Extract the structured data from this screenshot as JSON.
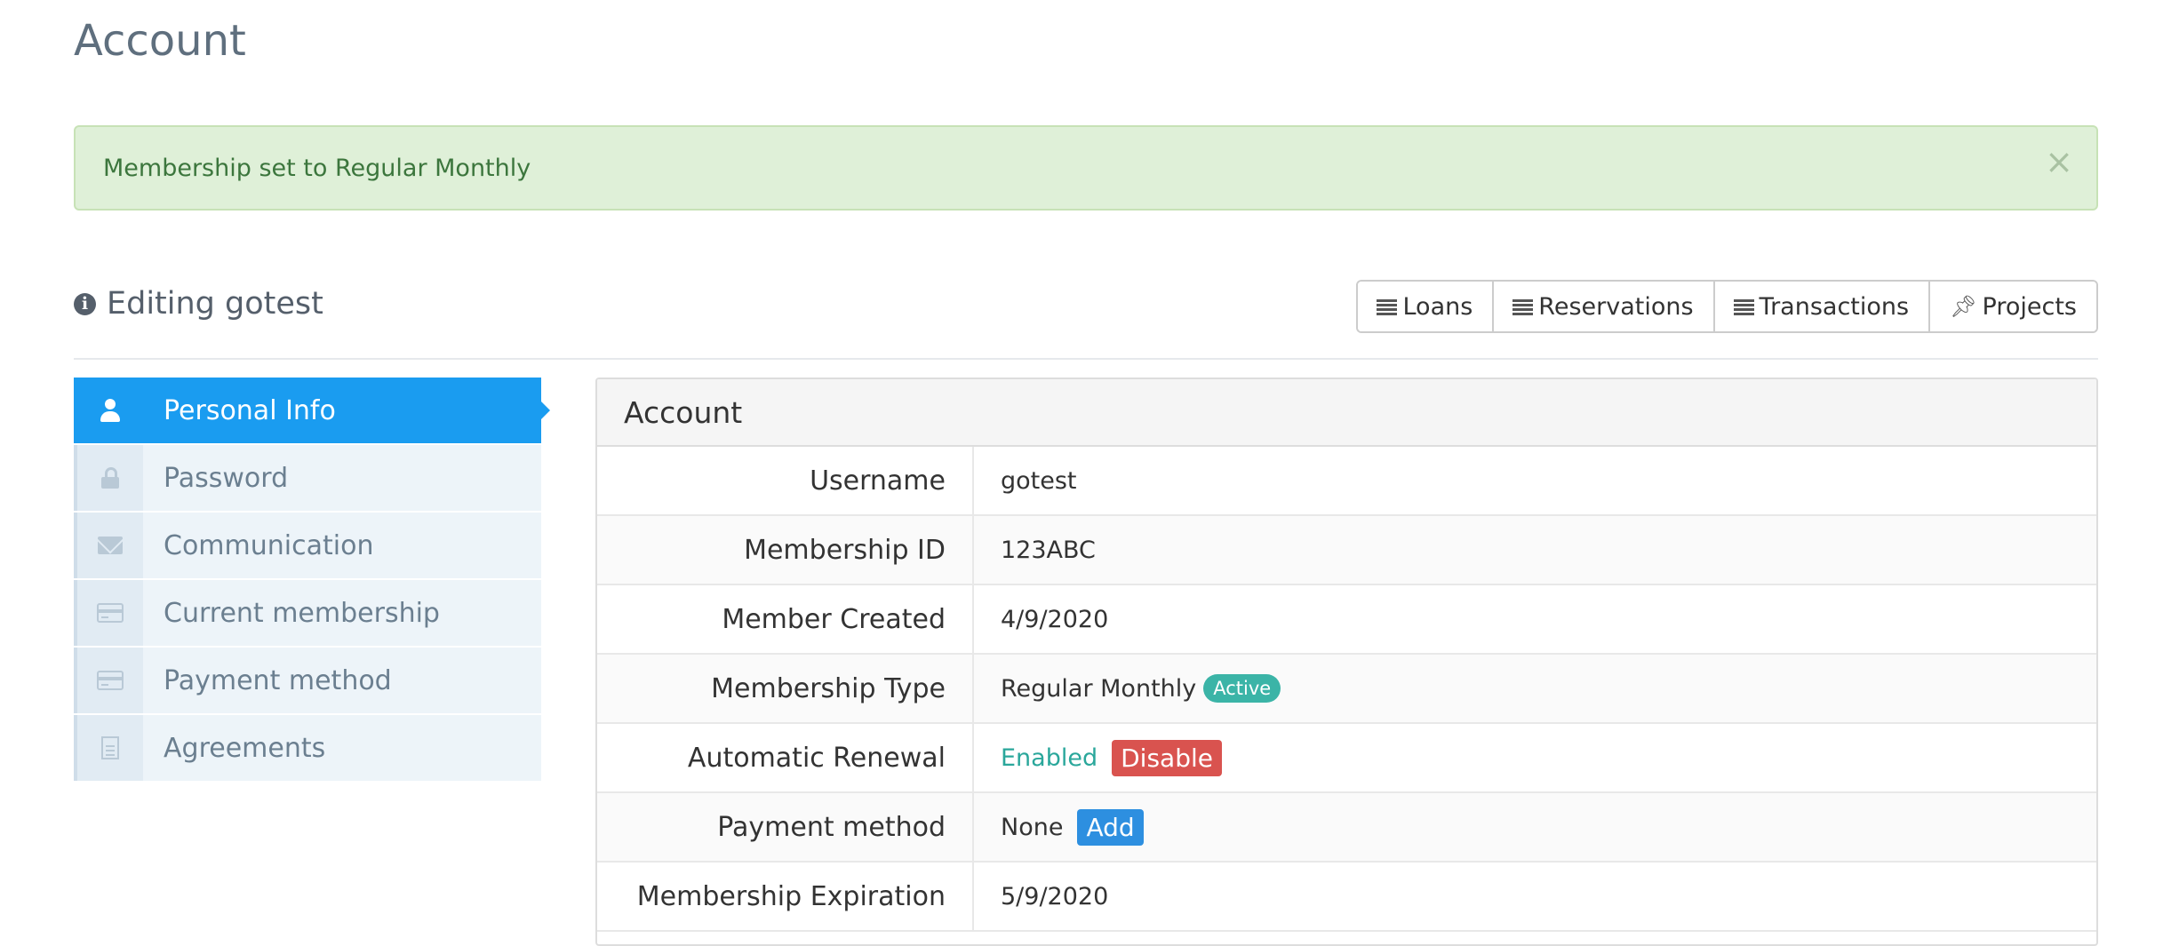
{
  "page": {
    "title": "Account"
  },
  "alert": {
    "message": "Membership set to Regular Monthly",
    "close_glyph": "×"
  },
  "section": {
    "title": "Editing gotest"
  },
  "toolbar": {
    "buttons": [
      {
        "label": "Loans",
        "icon": "list-icon"
      },
      {
        "label": "Reservations",
        "icon": "list-icon"
      },
      {
        "label": "Transactions",
        "icon": "list-icon"
      },
      {
        "label": "Projects",
        "icon": "pin-icon"
      }
    ]
  },
  "sidebar": {
    "items": [
      {
        "label": "Personal Info",
        "icon": "user-icon",
        "active": true
      },
      {
        "label": "Password",
        "icon": "lock-icon"
      },
      {
        "label": "Communication",
        "icon": "envelope-icon"
      },
      {
        "label": "Current membership",
        "icon": "credit-card-icon"
      },
      {
        "label": "Payment method",
        "icon": "credit-card-icon"
      },
      {
        "label": "Agreements",
        "icon": "document-icon"
      }
    ]
  },
  "panel": {
    "title": "Account",
    "rows": [
      {
        "label": "Username",
        "value": "gotest"
      },
      {
        "label": "Membership ID",
        "value": "123ABC"
      },
      {
        "label": "Member Created",
        "value": "4/9/2020"
      },
      {
        "label": "Membership Type",
        "value": "Regular Monthly",
        "badge": "Active"
      },
      {
        "label": "Automatic Renewal",
        "value": "Enabled",
        "action": "Disable"
      },
      {
        "label": "Payment method",
        "value": "None",
        "action": "Add"
      },
      {
        "label": "Membership Expiration",
        "value": "5/9/2020"
      }
    ]
  },
  "colors": {
    "primary": "#1a9cf0",
    "success_bg": "#dff0d8",
    "success_text": "#3c763d",
    "active_badge": "#3bb4a7",
    "danger": "#d9534f",
    "add_button": "#2d8fe0"
  }
}
